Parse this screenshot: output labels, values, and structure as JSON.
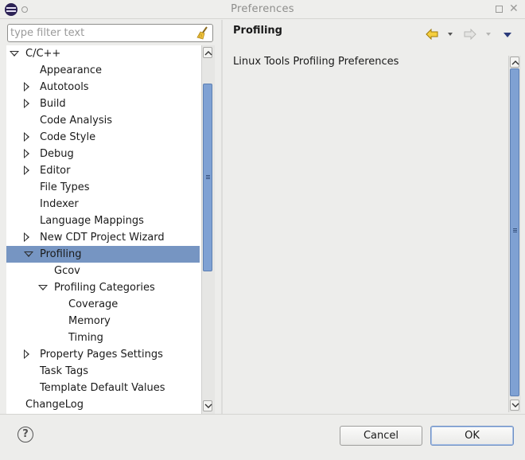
{
  "window": {
    "title": "Preferences"
  },
  "filter": {
    "placeholder": "type filter text",
    "value": ""
  },
  "tree": [
    {
      "label": "C/C++",
      "depth": 0,
      "toggle": "expanded",
      "selected": false
    },
    {
      "label": "Appearance",
      "depth": 1,
      "toggle": "none",
      "selected": false
    },
    {
      "label": "Autotools",
      "depth": 1,
      "toggle": "collapsed",
      "selected": false
    },
    {
      "label": "Build",
      "depth": 1,
      "toggle": "collapsed",
      "selected": false
    },
    {
      "label": "Code Analysis",
      "depth": 1,
      "toggle": "none",
      "selected": false
    },
    {
      "label": "Code Style",
      "depth": 1,
      "toggle": "collapsed",
      "selected": false
    },
    {
      "label": "Debug",
      "depth": 1,
      "toggle": "collapsed",
      "selected": false
    },
    {
      "label": "Editor",
      "depth": 1,
      "toggle": "collapsed",
      "selected": false
    },
    {
      "label": "File Types",
      "depth": 1,
      "toggle": "none",
      "selected": false
    },
    {
      "label": "Indexer",
      "depth": 1,
      "toggle": "none",
      "selected": false
    },
    {
      "label": "Language Mappings",
      "depth": 1,
      "toggle": "none",
      "selected": false
    },
    {
      "label": "New CDT Project Wizard",
      "depth": 1,
      "toggle": "collapsed",
      "selected": false
    },
    {
      "label": "Profiling",
      "depth": 1,
      "toggle": "expanded",
      "selected": true
    },
    {
      "label": "Gcov",
      "depth": 2,
      "toggle": "none",
      "selected": false
    },
    {
      "label": "Profiling Categories",
      "depth": 2,
      "toggle": "expanded",
      "selected": false
    },
    {
      "label": "Coverage",
      "depth": 3,
      "toggle": "none",
      "selected": false
    },
    {
      "label": "Memory",
      "depth": 3,
      "toggle": "none",
      "selected": false
    },
    {
      "label": "Timing",
      "depth": 3,
      "toggle": "none",
      "selected": false
    },
    {
      "label": "Property Pages Settings",
      "depth": 1,
      "toggle": "collapsed",
      "selected": false
    },
    {
      "label": "Task Tags",
      "depth": 1,
      "toggle": "none",
      "selected": false
    },
    {
      "label": "Template Default Values",
      "depth": 1,
      "toggle": "none",
      "selected": false
    },
    {
      "label": "ChangeLog",
      "depth": 0,
      "toggle": "none",
      "selected": false
    }
  ],
  "page": {
    "title": "Profiling",
    "description": "Linux Tools Profiling Preferences"
  },
  "buttons": {
    "cancel": "Cancel",
    "ok": "OK"
  },
  "icons": {
    "app": "eclipse-icon",
    "clear_filter": "broom-icon",
    "back": "back-arrow-icon",
    "forward": "forward-arrow-icon",
    "menu": "view-menu-icon",
    "help": "help-icon"
  },
  "colors": {
    "selection": "#7695c2",
    "scroll_thumb": "#7fa1d3",
    "back_arrow": "#e8b500"
  }
}
